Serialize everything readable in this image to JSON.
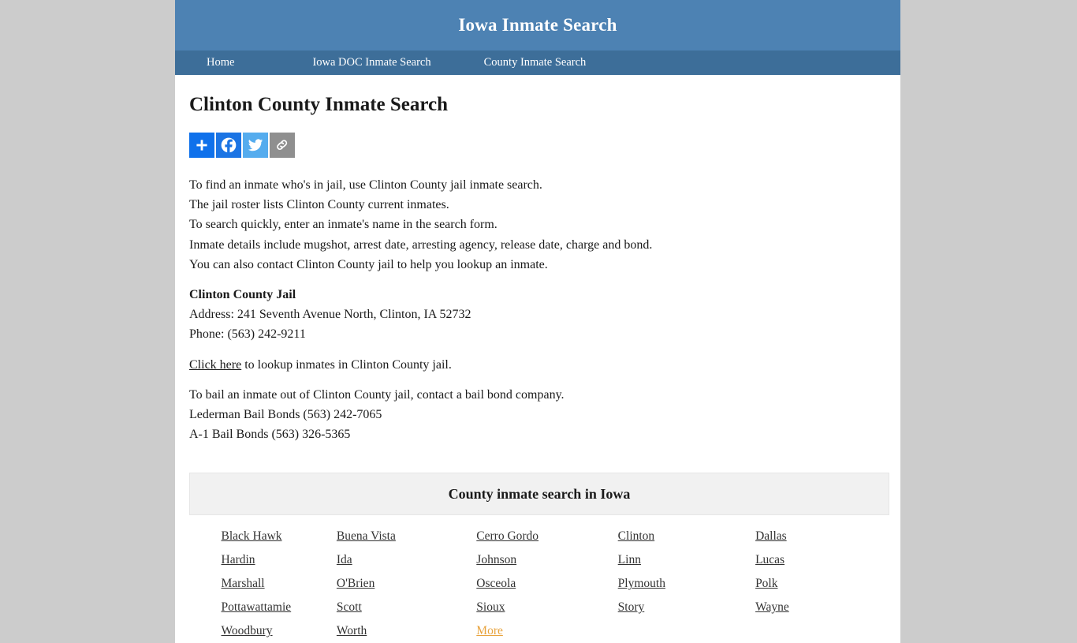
{
  "site": {
    "header_title": "Iowa Inmate Search",
    "header_bg": "#4d82b3",
    "nav_bg": "#3d6e99",
    "page_bg": "#cccccc",
    "content_bg": "#ffffff"
  },
  "nav": {
    "items": [
      {
        "label": "Home"
      },
      {
        "label": "Iowa DOC Inmate Search"
      },
      {
        "label": "County Inmate Search"
      }
    ]
  },
  "main": {
    "page_title": "Clinton County Inmate Search",
    "share": {
      "buttons": [
        {
          "name": "addthis-share-icon",
          "label": "Share"
        },
        {
          "name": "facebook-icon",
          "label": "Facebook"
        },
        {
          "name": "twitter-icon",
          "label": "Twitter"
        },
        {
          "name": "copy-link-icon",
          "label": "Copy Link"
        }
      ]
    },
    "intro_lines": [
      "To find an inmate who's in jail, use Clinton County jail inmate search.",
      "The jail roster lists Clinton County current inmates.",
      "To search quickly, enter an inmate's name in the search form.",
      "Inmate details include mugshot, arrest date, arresting agency, release date, charge and bond.",
      "You can also contact Clinton County jail to help you lookup an inmate."
    ],
    "jail": {
      "name": "Clinton County Jail",
      "address": "Address: 241 Seventh Avenue North, Clinton, IA 52732",
      "phone": "Phone: (563) 242-9211"
    },
    "lookup": {
      "link_text": "Click here",
      "rest_text": " to lookup inmates in Clinton County jail."
    },
    "bail": {
      "intro": "To bail an inmate out of Clinton County jail, contact a bail bond company.",
      "companies": [
        "Lederman Bail Bonds (563) 242-7065",
        "A-1 Bail Bonds (563) 326-5365"
      ]
    }
  },
  "county_table": {
    "header": "County inmate search in Iowa",
    "accent_color": "#e8a33d",
    "rows": [
      [
        {
          "label": "Black Hawk",
          "highlight": false
        },
        {
          "label": "Buena Vista",
          "highlight": false
        },
        {
          "label": "Cerro Gordo",
          "highlight": false
        },
        {
          "label": "Clinton",
          "highlight": false
        },
        {
          "label": "Dallas",
          "highlight": false
        }
      ],
      [
        {
          "label": "Hardin",
          "highlight": false
        },
        {
          "label": "Ida",
          "highlight": false
        },
        {
          "label": "Johnson",
          "highlight": false
        },
        {
          "label": "Linn",
          "highlight": false
        },
        {
          "label": "Lucas",
          "highlight": false
        }
      ],
      [
        {
          "label": "Marshall",
          "highlight": false
        },
        {
          "label": "O'Brien",
          "highlight": false
        },
        {
          "label": "Osceola",
          "highlight": false
        },
        {
          "label": "Plymouth",
          "highlight": false
        },
        {
          "label": "Polk",
          "highlight": false
        }
      ],
      [
        {
          "label": "Pottawattamie",
          "highlight": false
        },
        {
          "label": "Scott",
          "highlight": false
        },
        {
          "label": "Sioux",
          "highlight": false
        },
        {
          "label": "Story",
          "highlight": false
        },
        {
          "label": "Wayne",
          "highlight": false
        }
      ],
      [
        {
          "label": "Woodbury",
          "highlight": false
        },
        {
          "label": "Worth",
          "highlight": false
        },
        {
          "label": "More",
          "highlight": true
        },
        {
          "label": "",
          "highlight": false
        },
        {
          "label": "",
          "highlight": false
        }
      ]
    ]
  }
}
